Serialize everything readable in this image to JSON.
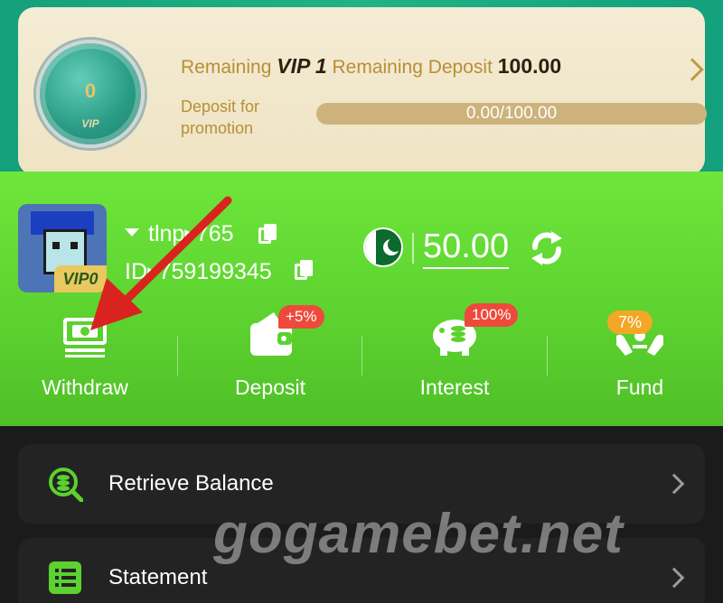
{
  "vip_card": {
    "medal_level": "0",
    "medal_label": "VIP",
    "remaining_label": "Remaining",
    "vip_level": "VIP 1",
    "remaining_deposit_label": "Remaining Deposit",
    "remaining_deposit_value": "100.00",
    "deposit_promo_label": "Deposit for promotion",
    "progress_text": "0.00/100.00",
    "progress_fraction": 0.0
  },
  "user": {
    "username": "tlnp▸765",
    "user_id": "ID▸759199345",
    "vip_badge": "VIP0",
    "balance": "50.00",
    "currency_flag": "pakistan-flag"
  },
  "actions": [
    {
      "label": "Withdraw",
      "icon": "withdraw-icon"
    },
    {
      "label": "Deposit",
      "icon": "wallet-icon",
      "tag": "+5%"
    },
    {
      "label": "Interest",
      "icon": "piggy-bank-icon",
      "tag": "100%"
    },
    {
      "label": "Fund",
      "icon": "fund-hands-icon",
      "tag": "7%"
    }
  ],
  "menu": [
    {
      "label": "Retrieve Balance",
      "icon": "retrieve-balance-icon"
    },
    {
      "label": "Statement",
      "icon": "statement-icon"
    }
  ],
  "watermark": "gogamebet.net",
  "colors": {
    "teal": "#1aa880",
    "gold_text": "#b78f35",
    "green": "#62d933",
    "red_tag": "#ee4a3c",
    "orange_tag": "#f4a726",
    "dark_bg": "#1b1b1b",
    "arrow": "#d9231e"
  }
}
